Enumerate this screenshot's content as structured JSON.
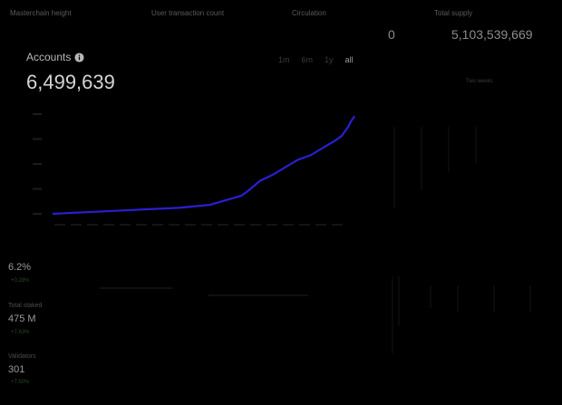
{
  "top_stats": [
    {
      "label": "Masterchain height",
      "value": ""
    },
    {
      "label": "User transaction count",
      "value": ""
    },
    {
      "label": "Circulation",
      "value": "0"
    },
    {
      "label": "Total supply",
      "value": "5,103,539,669"
    }
  ],
  "accounts": {
    "title": "Accounts",
    "info_icon": "info-icon",
    "value": "6,499,639"
  },
  "ranges": [
    {
      "label": "1m",
      "active": false
    },
    {
      "label": "6m",
      "active": false
    },
    {
      "label": "1y",
      "active": false
    },
    {
      "label": "all",
      "active": true
    }
  ],
  "two_weeks": "Two weeks",
  "metrics": {
    "apy": {
      "value": "6.2%",
      "change": "+0.28%"
    },
    "staked": {
      "label": "Total staked",
      "value": "475 M",
      "change": "+7.63%"
    },
    "validators": {
      "label": "Validators",
      "value": "301",
      "change": "+7.50%"
    }
  },
  "colors": {
    "line": "#2a1fd1",
    "background": "#000000"
  },
  "chart_data": {
    "type": "line",
    "series": [
      {
        "x": [
          0,
          10,
          20,
          30,
          40,
          50,
          60,
          62,
          66,
          70,
          74,
          78,
          82,
          86,
          90,
          92,
          94,
          95,
          96
        ],
        "y": [
          0,
          0.1,
          0.2,
          0.3,
          0.4,
          0.6,
          1.2,
          1.5,
          2.2,
          2.6,
          3.1,
          3.6,
          3.9,
          4.4,
          4.9,
          5.2,
          5.8,
          6.2,
          6.5
        ]
      }
    ],
    "xlim": [
      0,
      100
    ],
    "ylim": [
      0,
      7
    ],
    "grid": false
  }
}
